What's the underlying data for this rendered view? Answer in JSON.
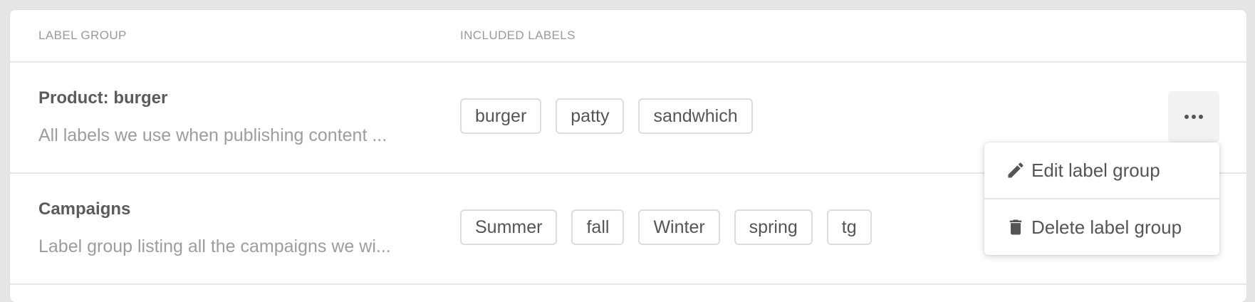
{
  "table": {
    "headers": {
      "label_group": "LABEL GROUP",
      "included_labels": "INCLUDED LABELS"
    },
    "rows": [
      {
        "title": "Product: burger",
        "description": "All labels we use when publishing content ...",
        "labels": [
          "burger",
          "patty",
          "sandwhich"
        ]
      },
      {
        "title": "Campaigns",
        "description": "Label group listing all the campaigns we wi...",
        "labels": [
          "Summer",
          "fall",
          "Winter",
          "spring",
          "tg"
        ]
      }
    ]
  },
  "actions_menu": {
    "trigger_icon": "more-horizontal-icon",
    "items": [
      {
        "label": "Edit label group",
        "icon": "pencil-icon"
      },
      {
        "label": "Delete label group",
        "icon": "trash-icon"
      }
    ]
  },
  "colors": {
    "background": "#e6e6e6",
    "card": "#ffffff",
    "muted_text": "#9d9d9d",
    "chip_border": "#dcdcdc",
    "menu_button_bg": "#f2f2f2"
  }
}
